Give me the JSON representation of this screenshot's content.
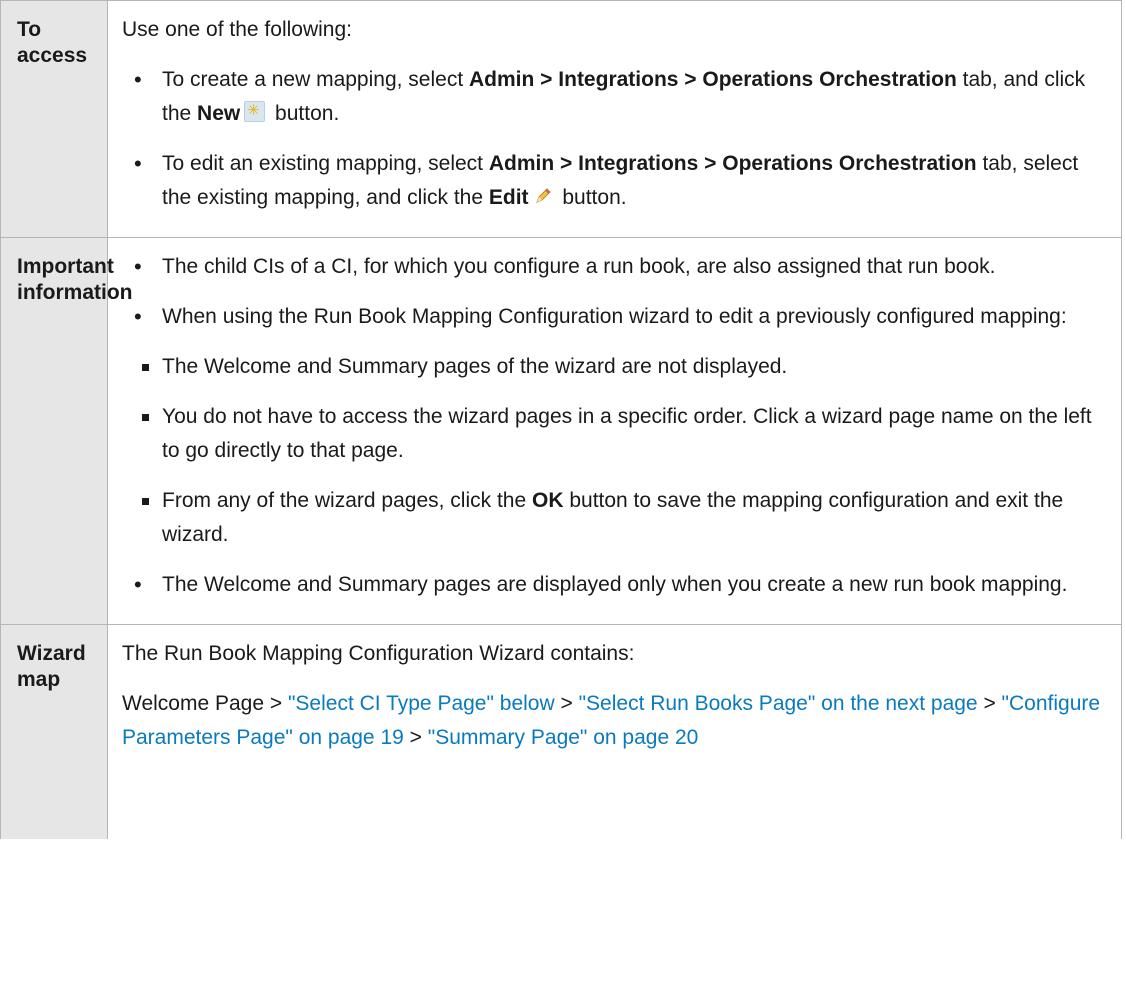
{
  "rows": [
    {
      "header": [
        "To access"
      ],
      "intro": "Use one of the following:",
      "bullets": [
        {
          "t1": "To create a new mapping, select ",
          "b1": "Admin > Integrations > Operations Orchestration",
          "t2": " tab, and click the ",
          "b2": "New",
          "icon": "new-icon",
          "t3": " button."
        },
        {
          "t1": "To edit an existing mapping, select ",
          "b1": "Admin > Integrations > Operations Orchestration",
          "t2": " tab, select the existing mapping, and click the ",
          "b2": "Edit",
          "icon": "edit-icon",
          "t3": " button."
        }
      ]
    },
    {
      "header": [
        "Important",
        "information"
      ],
      "bullets": [
        "The child CIs of a CI, for which you configure a run book, are also assigned that run book.",
        "When using the Run Book Mapping Configuration wizard to edit a previously configured mapping:"
      ],
      "sub_bullets": [
        "The Welcome and Summary pages of the wizard are not displayed.",
        "You do not have to access the wizard pages in a specific order. Click a wizard page name on the left to go directly to that page."
      ],
      "ok_item": {
        "t1": "From any of the wizard pages, click the ",
        "b1": "OK",
        "t2": " button to save the mapping configuration and exit the wizard."
      },
      "last_bullet": "The Welcome and Summary pages are displayed only when you create a new run book mapping."
    },
    {
      "header": [
        "Wizard",
        "map"
      ],
      "intro": "The Run Book Mapping Configuration Wizard contains:",
      "map": {
        "start": "Welcome Page",
        "sep": " > ",
        "links": [
          "\"Select CI Type Page\" below",
          "\"Select Run Books Page\" on the next page",
          "\"Configure Parameters Page\" on page 19",
          "\"Summary Page\" on page 20"
        ]
      }
    }
  ],
  "colors": {
    "header_bg": "#e6e6e6",
    "border": "#b5b5b5",
    "link": "#0a7abf"
  }
}
